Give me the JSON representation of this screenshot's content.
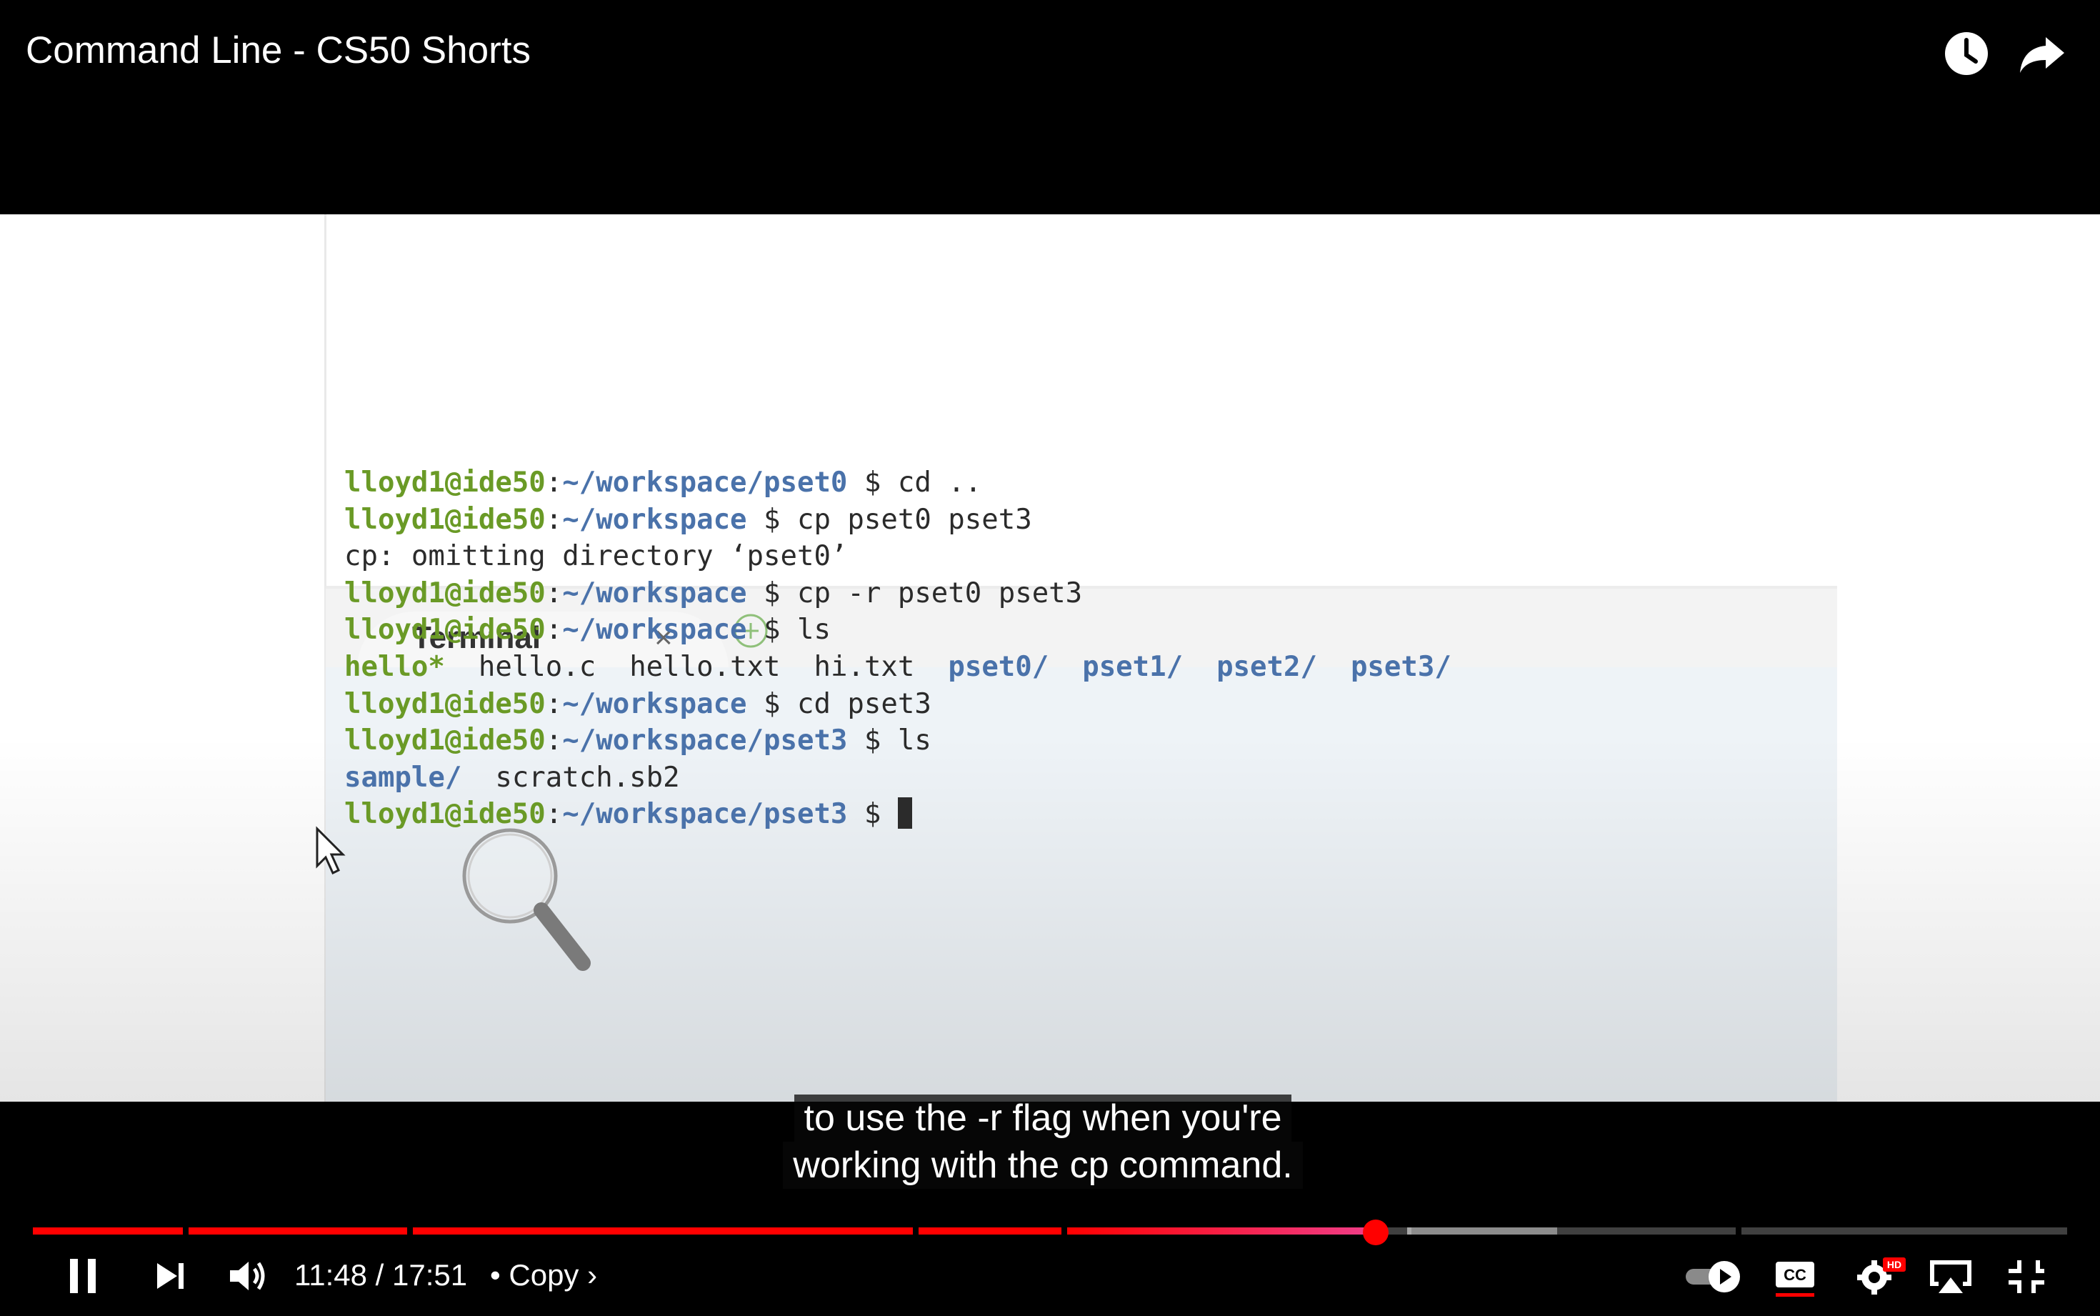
{
  "video": {
    "title": "Command Line - CS50 Shorts"
  },
  "top_actions": [
    {
      "name": "watch-later",
      "icon": "clock-icon"
    },
    {
      "name": "share",
      "icon": "share-arrow-icon"
    }
  ],
  "ide": {
    "tab_label": "Terminal",
    "tab_close": "×",
    "prompt_user": "lloyd1@ide50",
    "lines": [
      {
        "type": "prompt",
        "path": "~/workspace/pset0",
        "cmd": "cd .."
      },
      {
        "type": "prompt",
        "path": "~/workspace",
        "cmd": "cp pset0 pset3"
      },
      {
        "type": "output",
        "text": "cp: omitting directory ‘pset0’"
      },
      {
        "type": "prompt",
        "path": "~/workspace",
        "cmd": "cp -r pset0 pset3"
      },
      {
        "type": "prompt",
        "path": "~/workspace",
        "cmd": "ls"
      },
      {
        "type": "listing",
        "items": [
          {
            "text": "hello*",
            "kind": "exe"
          },
          {
            "text": "hello.c",
            "kind": "file"
          },
          {
            "text": "hello.txt",
            "kind": "file"
          },
          {
            "text": "hi.txt",
            "kind": "file"
          },
          {
            "text": "pset0/",
            "kind": "dir"
          },
          {
            "text": "pset1/",
            "kind": "dir"
          },
          {
            "text": "pset2/",
            "kind": "dir"
          },
          {
            "text": "pset3/",
            "kind": "dir"
          }
        ]
      },
      {
        "type": "prompt",
        "path": "~/workspace",
        "cmd": "cd pset3"
      },
      {
        "type": "prompt",
        "path": "~/workspace/pset3",
        "cmd": "ls"
      },
      {
        "type": "listing",
        "items": [
          {
            "text": "sample/",
            "kind": "dir"
          },
          {
            "text": "scratch.sb2",
            "kind": "file"
          }
        ]
      },
      {
        "type": "prompt",
        "path": "~/workspace/pset3",
        "cmd": "",
        "cursor": true
      }
    ]
  },
  "captions": {
    "line1": "to use the -r flag when you're",
    "line2": "working with the cp command."
  },
  "player": {
    "current_time": "11:48",
    "duration": "17:51",
    "time_separator": "/",
    "chapter": "• Copy ›",
    "progress_fraction": 0.66,
    "autoplay_on": true,
    "captions_on": true,
    "quality_badge": "HD"
  },
  "colors": {
    "accent": "#ff0000",
    "prompt_user": "#6a9a26",
    "prompt_path": "#4a72aa"
  }
}
